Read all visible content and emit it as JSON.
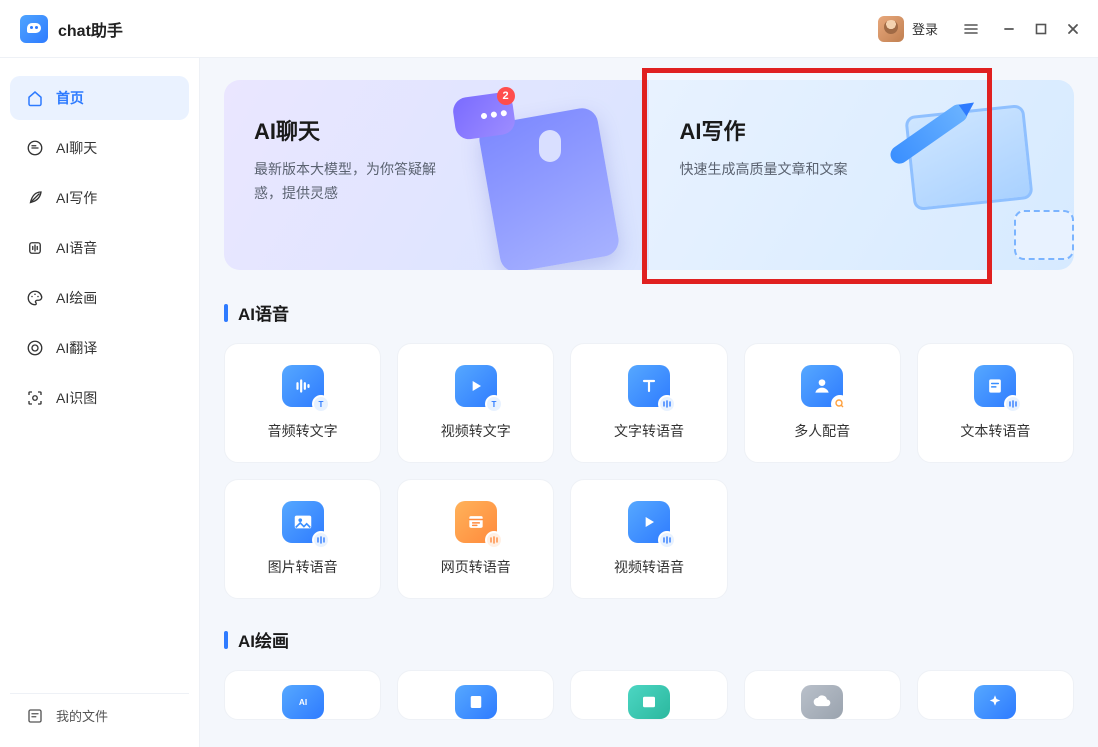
{
  "app": {
    "title": "chat助手",
    "login_label": "登录"
  },
  "sidebar": {
    "items": [
      {
        "label": "首页"
      },
      {
        "label": "AI聊天"
      },
      {
        "label": "AI写作"
      },
      {
        "label": "AI语音"
      },
      {
        "label": "AI绘画"
      },
      {
        "label": "AI翻译"
      },
      {
        "label": "AI识图"
      }
    ],
    "files_label": "我的文件"
  },
  "hero": {
    "chat": {
      "title": "AI聊天",
      "desc": "最新版本大模型，为你答疑解惑，提供灵感",
      "notif_count": "2"
    },
    "write": {
      "title": "AI写作",
      "desc": "快速生成高质量文章和文案"
    }
  },
  "sections": {
    "voice": {
      "title": "AI语音",
      "tools": [
        {
          "label": "音频转文字"
        },
        {
          "label": "视频转文字"
        },
        {
          "label": "文字转语音"
        },
        {
          "label": "多人配音"
        },
        {
          "label": "文本转语音"
        },
        {
          "label": "图片转语音"
        },
        {
          "label": "网页转语音"
        },
        {
          "label": "视频转语音"
        }
      ]
    },
    "draw": {
      "title": "AI绘画"
    }
  }
}
